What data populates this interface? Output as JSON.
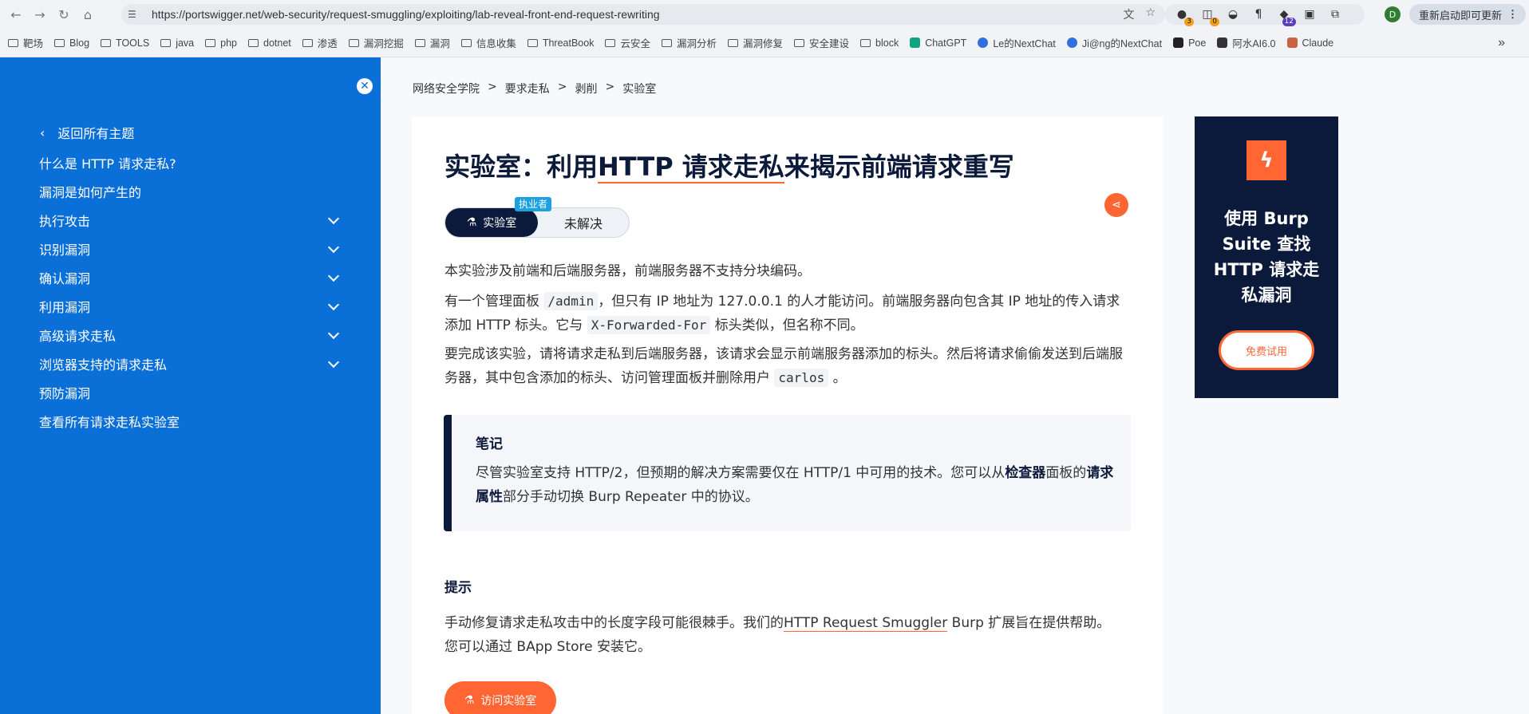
{
  "browser": {
    "url": "https://portswigger.net/web-security/request-smuggling/exploiting/lab-reveal-front-end-request-rewriting",
    "profile_initial": "D",
    "update_label": "重新启动即可更新",
    "ext_badges": [
      "3",
      "0",
      "12"
    ],
    "bookmarks": [
      "靶场",
      "Blog",
      "TOOLS",
      "java",
      "php",
      "dotnet",
      "渗透",
      "漏洞挖掘",
      "漏洞",
      "信息收集",
      "ThreatBook",
      "云安全",
      "漏洞分析",
      "漏洞修复",
      "安全建设",
      "block",
      "ChatGPT",
      "Le的NextChat",
      "Ji@ng的NextChat",
      "Poe",
      "阿水AI6.0",
      "Claude"
    ],
    "overflow": "»"
  },
  "sidebar": {
    "back_label": "返回所有主题",
    "items": [
      {
        "label": "什么是 HTTP 请求走私?",
        "expandable": false
      },
      {
        "label": "漏洞是如何产生的",
        "expandable": false
      },
      {
        "label": "执行攻击",
        "expandable": true
      },
      {
        "label": "识别漏洞",
        "expandable": true
      },
      {
        "label": "确认漏洞",
        "expandable": true
      },
      {
        "label": "利用漏洞",
        "expandable": true
      },
      {
        "label": "高级请求走私",
        "expandable": true
      },
      {
        "label": "浏览器支持的请求走私",
        "expandable": true
      },
      {
        "label": "预防漏洞",
        "expandable": false
      },
      {
        "label": "查看所有请求走私实验室",
        "expandable": false
      }
    ]
  },
  "breadcrumb": [
    "网络安全学院",
    "要求走私",
    "剥削",
    "实验室"
  ],
  "breadcrumb_sep": ">",
  "title": {
    "pre": "实验室：利用",
    "underlined": "HTTP 请求走私",
    "post": "来揭示前端请求重写"
  },
  "status": {
    "level": "执业者",
    "lab": "实验室",
    "state": "未解决"
  },
  "paragraphs": {
    "p1": "本实验涉及前端和后端服务器，前端服务器不支持分块编码。",
    "p2a": "有一个管理面板 ",
    "p2_code": "/admin",
    "p2b": "，但只有 IP 地址为 127.0.0.1 的人才能访问。前端服务器向包含其 IP 地址的传入请求添加 HTTP 标头。它与 ",
    "p2_code2": "X-Forwarded-For",
    "p2c": " 标头类似，但名称不同。",
    "p3a": "要完成该实验，请将请求走私到后端服务器，该请求会显示前端服务器添加的标头。然后将请求偷偷发送到后端服务器，其中包含添加的标头、访问管理面板并删除用户 ",
    "p3_code": "carlos",
    "p3b": " 。"
  },
  "note": {
    "title": "笔记",
    "text_a": "尽管实验室支持 HTTP/2，但预期的解决方案需要仅在 HTTP/1 中可用的技术。您可以从",
    "bold1": "检查器",
    "text_b": "面板的",
    "bold2": "请求属性",
    "text_c": "部分手动切换 Burp Repeater 中的协议。"
  },
  "hint": {
    "title": "提示",
    "text_a": "手动修复请求走私攻击中的长度字段可能很棘手。我们的",
    "link": "HTTP Request Smuggler",
    "text_b": " Burp 扩展旨在提供帮助。您可以通过 BApp Store 安装它。"
  },
  "access_button": "访问实验室",
  "ad": {
    "text": "使用 Burp Suite 查找 HTTP 请求走私漏洞",
    "button": "免费试用"
  }
}
